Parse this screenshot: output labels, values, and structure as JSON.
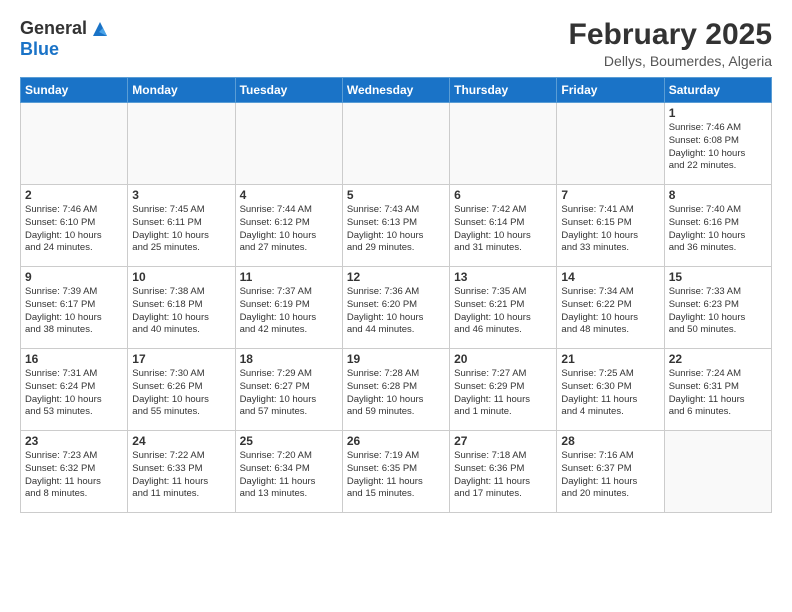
{
  "header": {
    "logo_general": "General",
    "logo_blue": "Blue",
    "month_year": "February 2025",
    "location": "Dellys, Boumerdes, Algeria"
  },
  "weekdays": [
    "Sunday",
    "Monday",
    "Tuesday",
    "Wednesday",
    "Thursday",
    "Friday",
    "Saturday"
  ],
  "weeks": [
    [
      {
        "day": "",
        "info": ""
      },
      {
        "day": "",
        "info": ""
      },
      {
        "day": "",
        "info": ""
      },
      {
        "day": "",
        "info": ""
      },
      {
        "day": "",
        "info": ""
      },
      {
        "day": "",
        "info": ""
      },
      {
        "day": "1",
        "info": "Sunrise: 7:46 AM\nSunset: 6:08 PM\nDaylight: 10 hours\nand 22 minutes."
      }
    ],
    [
      {
        "day": "2",
        "info": "Sunrise: 7:46 AM\nSunset: 6:10 PM\nDaylight: 10 hours\nand 24 minutes."
      },
      {
        "day": "3",
        "info": "Sunrise: 7:45 AM\nSunset: 6:11 PM\nDaylight: 10 hours\nand 25 minutes."
      },
      {
        "day": "4",
        "info": "Sunrise: 7:44 AM\nSunset: 6:12 PM\nDaylight: 10 hours\nand 27 minutes."
      },
      {
        "day": "5",
        "info": "Sunrise: 7:43 AM\nSunset: 6:13 PM\nDaylight: 10 hours\nand 29 minutes."
      },
      {
        "day": "6",
        "info": "Sunrise: 7:42 AM\nSunset: 6:14 PM\nDaylight: 10 hours\nand 31 minutes."
      },
      {
        "day": "7",
        "info": "Sunrise: 7:41 AM\nSunset: 6:15 PM\nDaylight: 10 hours\nand 33 minutes."
      },
      {
        "day": "8",
        "info": "Sunrise: 7:40 AM\nSunset: 6:16 PM\nDaylight: 10 hours\nand 36 minutes."
      }
    ],
    [
      {
        "day": "9",
        "info": "Sunrise: 7:39 AM\nSunset: 6:17 PM\nDaylight: 10 hours\nand 38 minutes."
      },
      {
        "day": "10",
        "info": "Sunrise: 7:38 AM\nSunset: 6:18 PM\nDaylight: 10 hours\nand 40 minutes."
      },
      {
        "day": "11",
        "info": "Sunrise: 7:37 AM\nSunset: 6:19 PM\nDaylight: 10 hours\nand 42 minutes."
      },
      {
        "day": "12",
        "info": "Sunrise: 7:36 AM\nSunset: 6:20 PM\nDaylight: 10 hours\nand 44 minutes."
      },
      {
        "day": "13",
        "info": "Sunrise: 7:35 AM\nSunset: 6:21 PM\nDaylight: 10 hours\nand 46 minutes."
      },
      {
        "day": "14",
        "info": "Sunrise: 7:34 AM\nSunset: 6:22 PM\nDaylight: 10 hours\nand 48 minutes."
      },
      {
        "day": "15",
        "info": "Sunrise: 7:33 AM\nSunset: 6:23 PM\nDaylight: 10 hours\nand 50 minutes."
      }
    ],
    [
      {
        "day": "16",
        "info": "Sunrise: 7:31 AM\nSunset: 6:24 PM\nDaylight: 10 hours\nand 53 minutes."
      },
      {
        "day": "17",
        "info": "Sunrise: 7:30 AM\nSunset: 6:26 PM\nDaylight: 10 hours\nand 55 minutes."
      },
      {
        "day": "18",
        "info": "Sunrise: 7:29 AM\nSunset: 6:27 PM\nDaylight: 10 hours\nand 57 minutes."
      },
      {
        "day": "19",
        "info": "Sunrise: 7:28 AM\nSunset: 6:28 PM\nDaylight: 10 hours\nand 59 minutes."
      },
      {
        "day": "20",
        "info": "Sunrise: 7:27 AM\nSunset: 6:29 PM\nDaylight: 11 hours\nand 1 minute."
      },
      {
        "day": "21",
        "info": "Sunrise: 7:25 AM\nSunset: 6:30 PM\nDaylight: 11 hours\nand 4 minutes."
      },
      {
        "day": "22",
        "info": "Sunrise: 7:24 AM\nSunset: 6:31 PM\nDaylight: 11 hours\nand 6 minutes."
      }
    ],
    [
      {
        "day": "23",
        "info": "Sunrise: 7:23 AM\nSunset: 6:32 PM\nDaylight: 11 hours\nand 8 minutes."
      },
      {
        "day": "24",
        "info": "Sunrise: 7:22 AM\nSunset: 6:33 PM\nDaylight: 11 hours\nand 11 minutes."
      },
      {
        "day": "25",
        "info": "Sunrise: 7:20 AM\nSunset: 6:34 PM\nDaylight: 11 hours\nand 13 minutes."
      },
      {
        "day": "26",
        "info": "Sunrise: 7:19 AM\nSunset: 6:35 PM\nDaylight: 11 hours\nand 15 minutes."
      },
      {
        "day": "27",
        "info": "Sunrise: 7:18 AM\nSunset: 6:36 PM\nDaylight: 11 hours\nand 17 minutes."
      },
      {
        "day": "28",
        "info": "Sunrise: 7:16 AM\nSunset: 6:37 PM\nDaylight: 11 hours\nand 20 minutes."
      },
      {
        "day": "",
        "info": ""
      }
    ]
  ]
}
